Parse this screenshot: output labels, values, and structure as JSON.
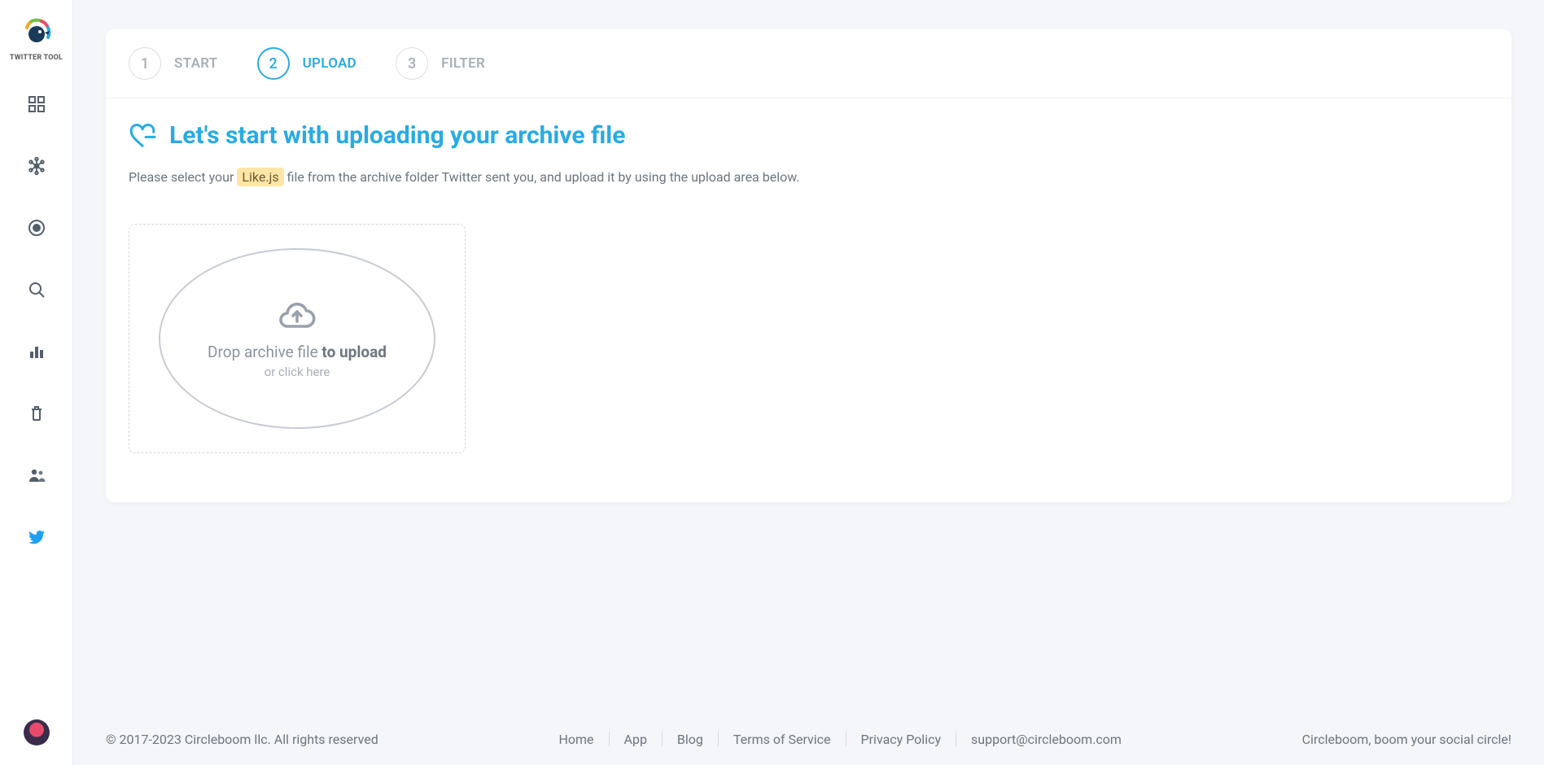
{
  "sidebar": {
    "brand_label": "TWITTER TOOL"
  },
  "stepper": {
    "steps": [
      {
        "num": "1",
        "label": "START"
      },
      {
        "num": "2",
        "label": "UPLOAD"
      },
      {
        "num": "3",
        "label": "FILTER"
      }
    ],
    "active_index": 1
  },
  "content": {
    "headline": "Let's start with uploading your archive file",
    "desc_pre": "Please select your ",
    "desc_highlight": "Like.js",
    "desc_post": " file from the archive folder Twitter sent you, and upload it by using the upload area below.",
    "drop_line1_pre": "Drop archive file ",
    "drop_line1_bold": "to upload",
    "drop_line2": "or click here"
  },
  "footer": {
    "copyright": "© 2017-2023 Circleboom llc. All rights reserved",
    "links": {
      "home": "Home",
      "app": "App",
      "blog": "Blog",
      "tos": "Terms of Service",
      "privacy": "Privacy Policy",
      "support": "support@circleboom.com"
    },
    "tagline": "Circleboom, boom your social circle!"
  }
}
